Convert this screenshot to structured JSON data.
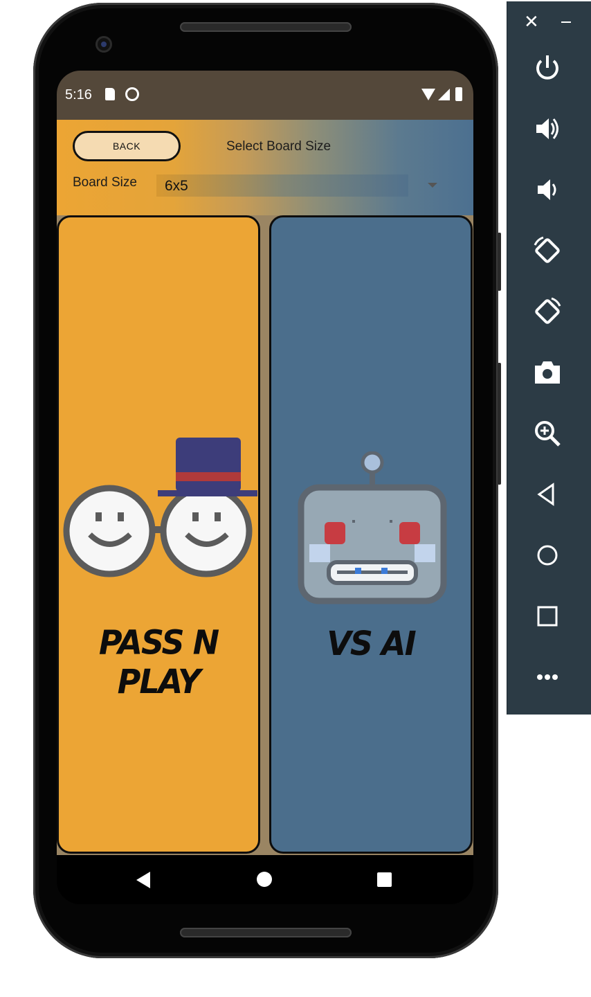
{
  "status_bar": {
    "time": "5:16"
  },
  "header": {
    "back_label": "BACK",
    "title": "Select Board Size"
  },
  "board_size": {
    "label": "Board Size",
    "selected": "6x5"
  },
  "modes": [
    {
      "label": "PASS N PLAY",
      "icon": "two-smileys-with-top-hat-icon"
    },
    {
      "label": "VS AI",
      "icon": "robot-head-icon"
    }
  ],
  "nav_bar": {
    "icons": [
      "back-triangle-icon",
      "home-circle-icon",
      "recents-square-icon"
    ]
  },
  "emulator_toolbar": {
    "close_glyph": "✕",
    "icons": [
      "power-icon",
      "volume-up-icon",
      "volume-down-icon",
      "rotate-left-icon",
      "rotate-right-icon",
      "camera-icon",
      "zoom-icon",
      "back-icon",
      "home-icon",
      "overview-icon",
      "more-icon"
    ]
  },
  "colors": {
    "pass_n_play_card": "#eca535",
    "vs_ai_card": "#4b6e8c",
    "status_bar": "#54483a",
    "back_button": "#f5dbb2",
    "toolbar": "#2c3b45"
  }
}
